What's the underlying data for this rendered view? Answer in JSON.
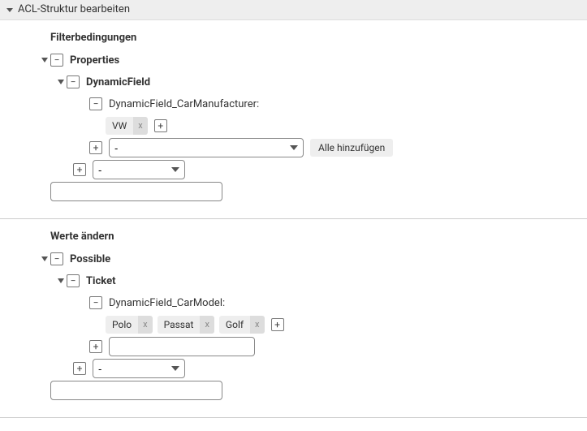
{
  "header": {
    "title": "ACL-Struktur bearbeiten"
  },
  "filter": {
    "title": "Filterbedingungen",
    "root": {
      "label": "Properties"
    },
    "child1": {
      "label": "DynamicField"
    },
    "leaf": {
      "label": "DynamicField_CarManufacturer:"
    },
    "tags": [
      "VW"
    ],
    "tag_remove": "x",
    "select1_value": "-",
    "add_all": "Alle hinzufügen",
    "select2_value": "-"
  },
  "change": {
    "title": "Werte ändern",
    "root": {
      "label": "Possible"
    },
    "child1": {
      "label": "Ticket"
    },
    "leaf": {
      "label": "DynamicField_CarModel:"
    },
    "tags": [
      "Polo",
      "Passat",
      "Golf"
    ],
    "tag_remove": "x",
    "select2_value": "-"
  }
}
